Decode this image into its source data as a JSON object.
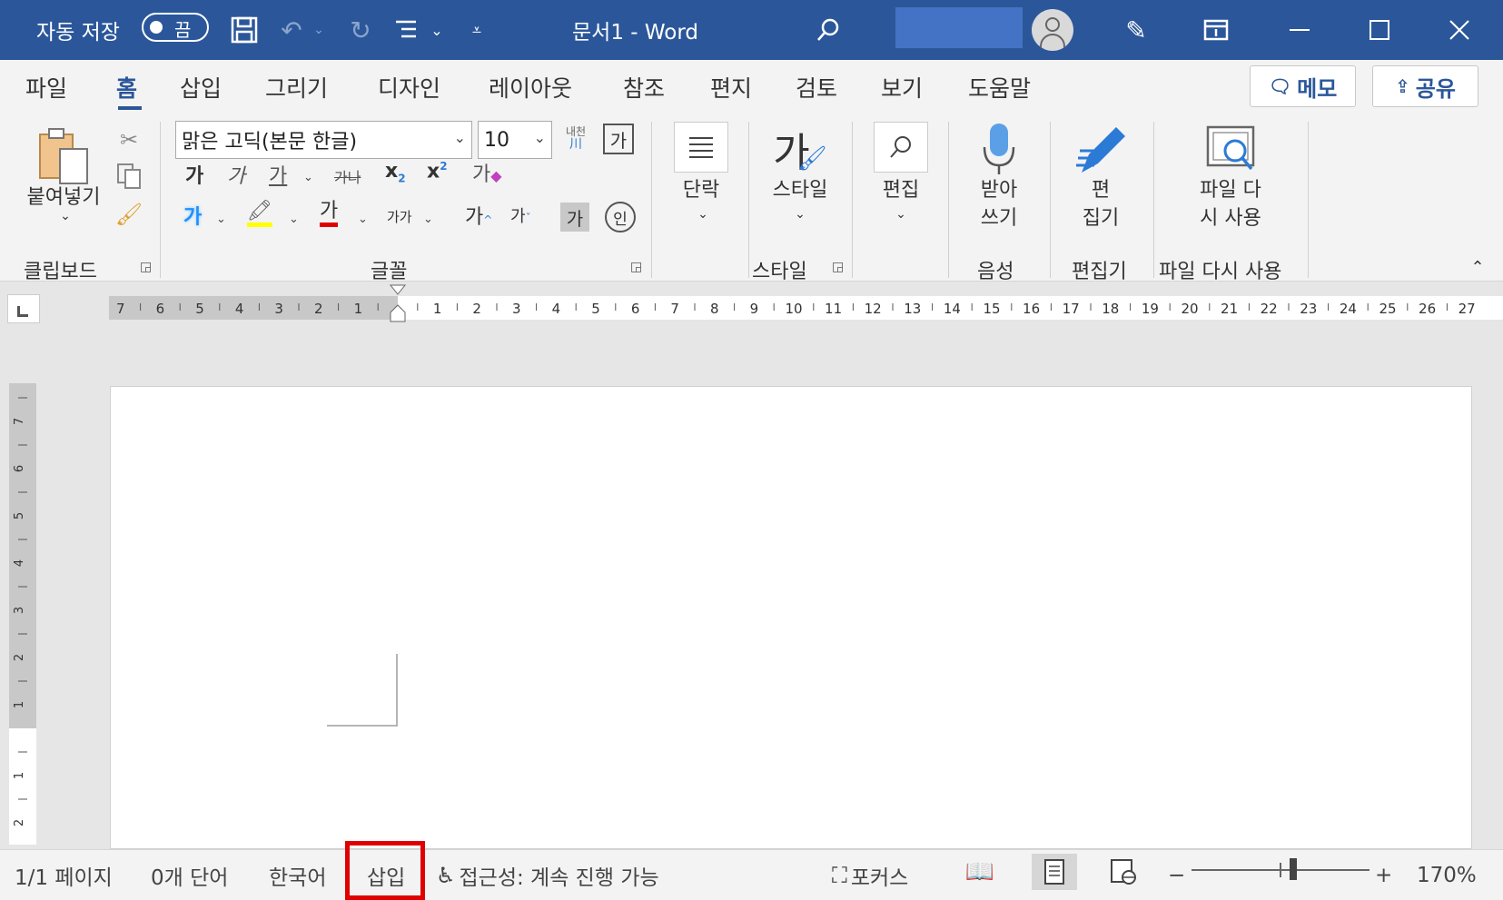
{
  "titlebar": {
    "autosave_label": "자동 저장",
    "autosave_state": "끔",
    "document_title": "문서1  -  Word",
    "background": "#2b579a"
  },
  "tabs": [
    {
      "label": "파일"
    },
    {
      "label": "홈"
    },
    {
      "label": "삽입"
    },
    {
      "label": "그리기"
    },
    {
      "label": "디자인"
    },
    {
      "label": "레이아웃"
    },
    {
      "label": "참조"
    },
    {
      "label": "편지"
    },
    {
      "label": "검토"
    },
    {
      "label": "보기"
    },
    {
      "label": "도움말"
    }
  ],
  "active_tab": "홈",
  "top_buttons": {
    "memo": "메모",
    "share": "공유"
  },
  "ribbon": {
    "clipboard": {
      "paste_label": "붙여넣기",
      "group_label": "클립보드"
    },
    "font": {
      "font_name": "맑은 고딕(본문 한글)",
      "font_size": "10",
      "group_label": "글꼴",
      "bold": "가",
      "italic": "가",
      "underline": "가",
      "strike": "가나",
      "subscript": "x",
      "sub_mark": "2",
      "superscript": "x",
      "sup_mark": "2",
      "clear_format": "가",
      "effect": "가",
      "highlight": "가",
      "font_color": "가",
      "char_spacing": "가가",
      "grow": "가",
      "shrink": "가",
      "shade": "가",
      "enclose": "인",
      "phonetic_top": "내천",
      "phonetic_bottom": "川",
      "box": "가"
    },
    "paragraph": {
      "label": "단락"
    },
    "styles": {
      "label": "스타일",
      "group_label": "스타일",
      "glyph": "가"
    },
    "editing": {
      "label": "편집"
    },
    "voice": {
      "label_line1": "받아",
      "label_line2": "쓰기",
      "group_label": "음성"
    },
    "editor": {
      "label_line1": "편",
      "label_line2": "집기",
      "group_label": "편집기"
    },
    "reuse": {
      "label_line1": "파일 다",
      "label_line2": "시 사용",
      "group_label": "파일 다시 사용"
    }
  },
  "ruler": {
    "left_numbers": [
      "7",
      "6",
      "5",
      "4",
      "3",
      "2",
      "1"
    ],
    "right_numbers": [
      "1",
      "2",
      "3",
      "4",
      "5",
      "6",
      "7",
      "8",
      "9",
      "10",
      "11",
      "12",
      "13",
      "14",
      "15",
      "16",
      "17",
      "18",
      "19",
      "20",
      "21",
      "22",
      "23",
      "24",
      "25",
      "26",
      "27"
    ],
    "vertical_numbers": [
      "7",
      "6",
      "5",
      "4",
      "3",
      "2",
      "1",
      "1",
      "2"
    ]
  },
  "statusbar": {
    "page": "1/1 페이지",
    "words": "0개 단어",
    "language": "한국어",
    "insert_mode": "삽입",
    "accessibility": "접근성: 계속 진행 가능",
    "focus": "포커스",
    "zoom_minus": "−",
    "zoom_plus": "+",
    "zoom": "170%"
  },
  "colors": {
    "accent": "#2b579a",
    "highlight_yellow": "#ffff00",
    "font_red": "#e00000",
    "effect_blue": "#1e90ff",
    "insert_box": "#e00000"
  }
}
